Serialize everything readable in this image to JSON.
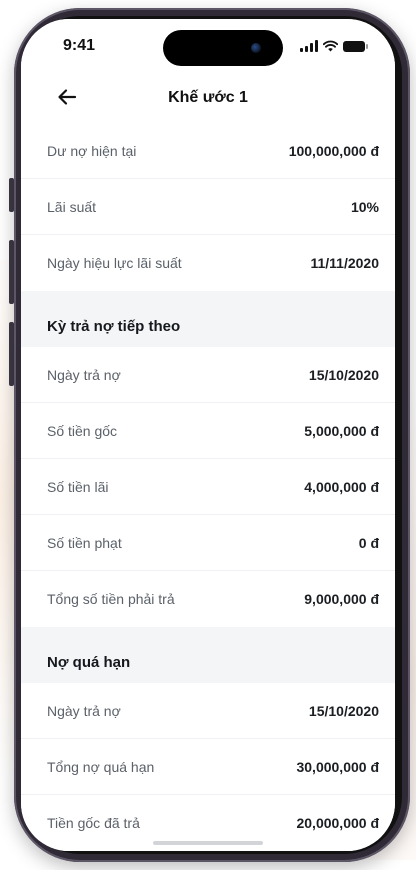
{
  "status_bar": {
    "time": "9:41"
  },
  "header": {
    "title": "Khế ước 1"
  },
  "summary": [
    {
      "label": "Dư nợ hiện tại",
      "value": "100,000,000 đ"
    },
    {
      "label": "Lãi suất",
      "value": "10%"
    },
    {
      "label": "Ngày hiệu lực lãi suất",
      "value": "11/11/2020"
    }
  ],
  "next_payment": {
    "title": "Kỳ trả nợ tiếp theo",
    "rows": [
      {
        "label": "Ngày trả nợ",
        "value": "15/10/2020"
      },
      {
        "label": "Số tiền gốc",
        "value": "5,000,000 đ"
      },
      {
        "label": "Số tiền lãi",
        "value": "4,000,000 đ"
      },
      {
        "label": "Số tiền phạt",
        "value": "0 đ"
      },
      {
        "label": "Tổng số tiền phải trả",
        "value": "9,000,000 đ"
      }
    ]
  },
  "overdue": {
    "title": "Nợ quá hạn",
    "rows": [
      {
        "label": "Ngày trả nợ",
        "value": "15/10/2020"
      },
      {
        "label": "Tổng nợ quá hạn",
        "value": "30,000,000 đ"
      },
      {
        "label": "Tiền gốc đã trả",
        "value": "20,000,000 đ"
      }
    ]
  },
  "icons": {
    "back": "arrow-left-icon",
    "signal": "signal-icon",
    "wifi": "wifi-icon",
    "battery": "battery-icon"
  },
  "colors": {
    "section_bg": "#f4f5f7",
    "label": "#5b6169",
    "value": "#1b1e22",
    "phone_frame": "#2f2a36"
  }
}
